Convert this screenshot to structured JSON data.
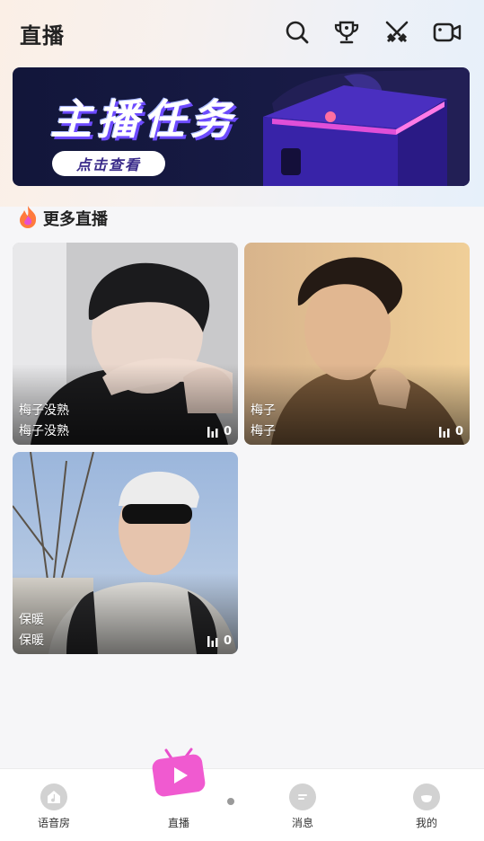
{
  "header": {
    "title": "直播",
    "icons": [
      "search-icon",
      "trophy-icon",
      "swords-icon",
      "video-camera-icon"
    ]
  },
  "banner": {
    "title": "主播任务",
    "button_label": "点击查看"
  },
  "section": {
    "icon": "flame-icon",
    "title": "更多直播"
  },
  "cards": [
    {
      "line1": "梅子没熟",
      "line2": "梅子没熟",
      "viewers": "0"
    },
    {
      "line1": "梅子",
      "line2": "梅子",
      "viewers": "0"
    },
    {
      "line1": "保暖",
      "line2": "保暖",
      "viewers": "0"
    }
  ],
  "tabbar": {
    "tabs": [
      {
        "label": "语音房",
        "icon": "music-house-icon"
      },
      {
        "label": "直播",
        "icon": "tv-play-icon"
      },
      {
        "label": "消息",
        "icon": "chat-bubble-icon"
      },
      {
        "label": "我的",
        "icon": "profile-face-icon"
      }
    ]
  },
  "colors": {
    "accent_pink": "#f04fc8",
    "banner_bg": "#12163a",
    "banner_purple": "#6d4bff"
  }
}
